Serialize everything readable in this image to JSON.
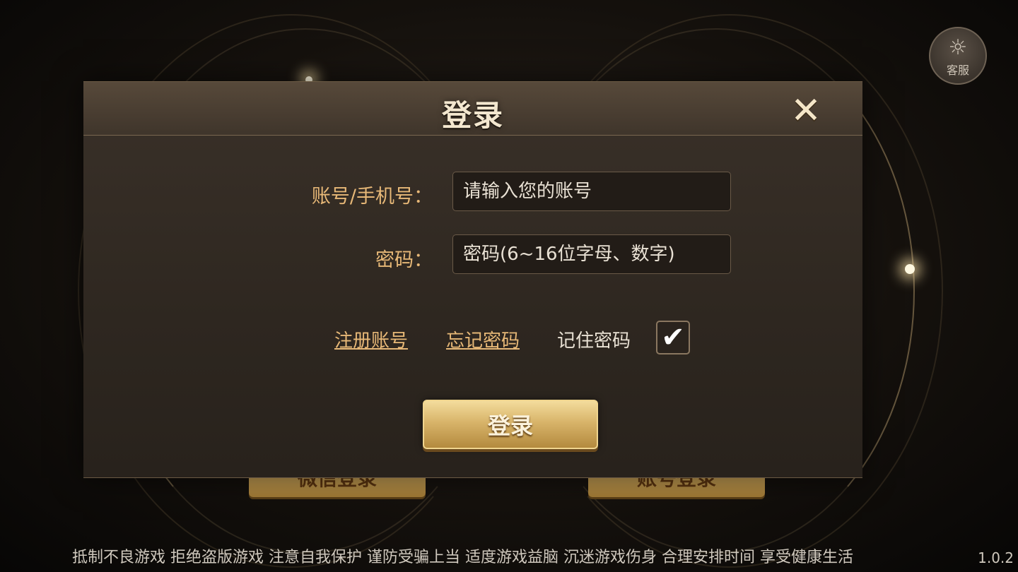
{
  "support": {
    "icon": "headset-icon",
    "label": "客服"
  },
  "background_buttons": {
    "left_label": "微信登录",
    "right_label": "账号登录"
  },
  "dialog": {
    "title": "登录",
    "close_icon": "close-icon",
    "account": {
      "label": "账号/手机号：",
      "placeholder": "请输入您的账号"
    },
    "password": {
      "label": "密码：",
      "placeholder": "密码(6~16位字母、数字)"
    },
    "register_link": "注册账号",
    "forgot_link": "忘记密码",
    "remember": {
      "label": "记住密码",
      "checked": true,
      "check_glyph": "✔"
    },
    "login_button": "登录"
  },
  "footer": {
    "notice": "抵制不良游戏 拒绝盗版游戏 注意自我保护 谨防受骗上当 适度游戏益脑 沉迷游戏伤身 合理安排时间 享受健康生活",
    "version": "1.0.2"
  },
  "colors": {
    "accent": "#e7b877",
    "button_gold": "#d8b46a",
    "panel": "#2e2720"
  }
}
